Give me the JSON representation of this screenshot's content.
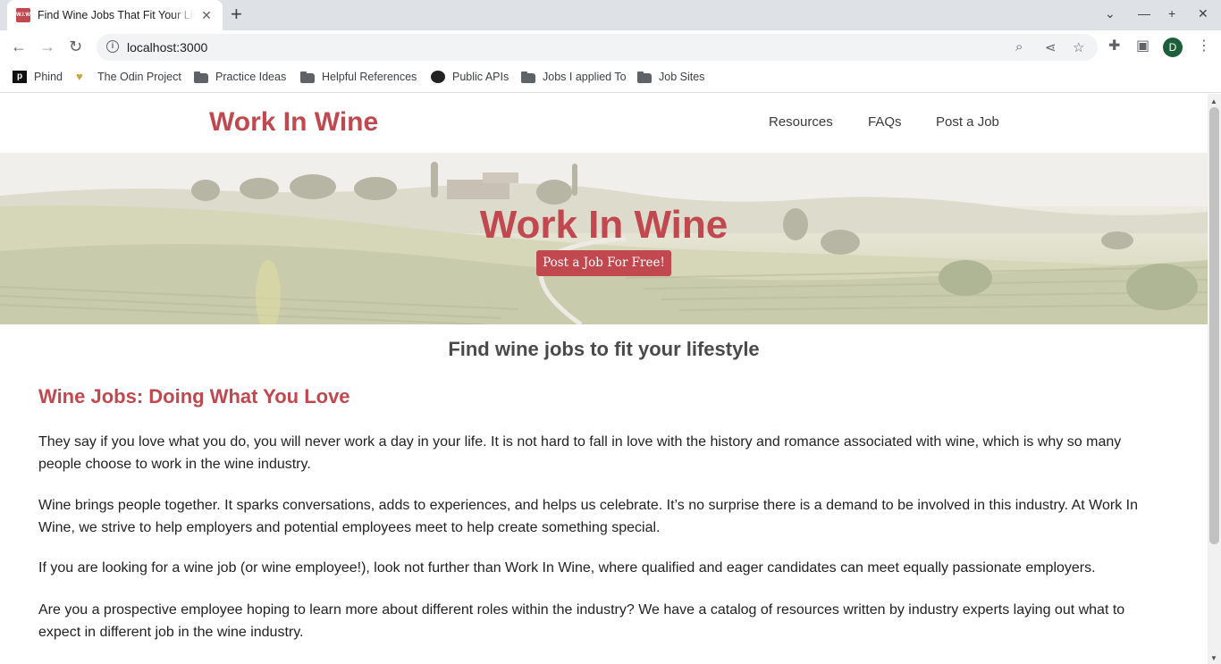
{
  "browser": {
    "tab_title": "Find Wine Jobs That Fit Your Life",
    "tab_favicon_text": "W.I.W",
    "url": "localhost:3000",
    "profile_initial": "D",
    "bookmarks": [
      {
        "label": "Phind",
        "icon": "phind-icon"
      },
      {
        "label": "The Odin Project",
        "icon": "odin-icon"
      },
      {
        "label": "Practice Ideas",
        "icon": "folder-icon"
      },
      {
        "label": "Helpful References",
        "icon": "folder-icon"
      },
      {
        "label": "Public APIs",
        "icon": "github-icon"
      },
      {
        "label": "Jobs I applied To",
        "icon": "folder-icon"
      },
      {
        "label": "Job Sites",
        "icon": "folder-icon"
      }
    ]
  },
  "site": {
    "logo": "Work In Wine",
    "nav": [
      "Resources",
      "FAQs",
      "Post a Job"
    ],
    "hero": {
      "title": "Work In Wine",
      "cta": "Post a Job For Free!"
    },
    "subtitle": "Find wine jobs to fit your lifestyle",
    "section_heading": "Wine Jobs: Doing What You Love",
    "paragraphs": [
      "They say if you love what you do, you will never work a day in your life. It is not hard to fall in love with the history and romance associated with wine, which is why so many people choose to work in the wine industry.",
      "Wine brings people together. It sparks conversations, adds to experiences, and helps us celebrate. It’s no surprise there is a demand to be involved in this industry. At Work In Wine, we strive to help employers and potential employees meet to help create something special.",
      "If you are looking for a wine job (or wine employee!), look not further than Work In Wine, where qualified and eager candidates can meet equally passionate employers.",
      "Are you a prospective employee hoping to learn more about different roles within the industry? We have a catalog of resources written by industry experts laying out what to expect in different job in the wine industry."
    ]
  },
  "colors": {
    "brand": "#c1484f",
    "text": "#222222",
    "subtitle": "#4a4a4a"
  }
}
